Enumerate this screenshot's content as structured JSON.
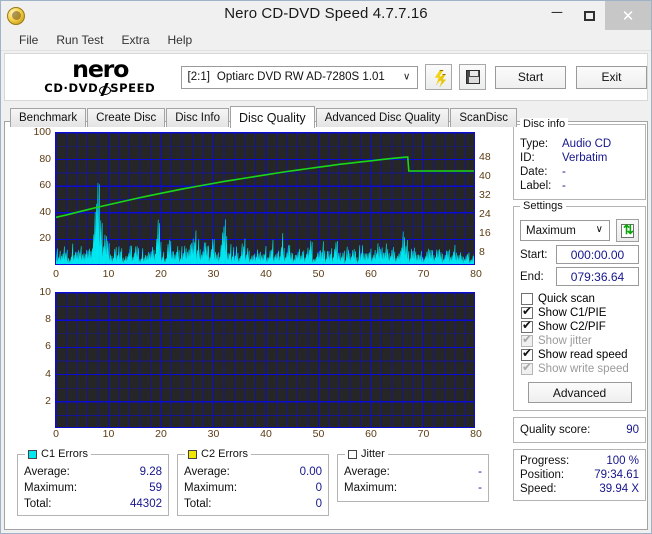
{
  "window": {
    "title": "Nero CD-DVD Speed 4.7.7.16",
    "app_icon": "nero-disc-icon",
    "minimize": "−",
    "maximize": "□",
    "close": "✕"
  },
  "menu": [
    {
      "label": "File"
    },
    {
      "label": "Run Test"
    },
    {
      "label": "Extra"
    },
    {
      "label": "Help"
    }
  ],
  "logo": {
    "main": "nero",
    "left": "CD·DVD",
    "right": "SPEED"
  },
  "toolbar": {
    "drive_id": "[2:1]",
    "drive_name": "Optiarc DVD RW AD-7280S 1.01",
    "caret": "∨",
    "burn_icon": "burn-icon",
    "save_icon": "save-icon",
    "start_label": "Start",
    "exit_label": "Exit"
  },
  "tabs": [
    {
      "label": "Benchmark",
      "active": false
    },
    {
      "label": "Create Disc",
      "active": false
    },
    {
      "label": "Disc Info",
      "active": false
    },
    {
      "label": "Disc Quality",
      "active": true
    },
    {
      "label": "Advanced Disc Quality",
      "active": false
    },
    {
      "label": "ScanDisc",
      "active": false
    }
  ],
  "disc_info": {
    "label": "Disc info",
    "rows": [
      {
        "k": "Type:",
        "v": "Audio CD"
      },
      {
        "k": "ID:",
        "v": "Verbatim"
      },
      {
        "k": "Date:",
        "v": "-"
      },
      {
        "k": "Label:",
        "v": "-"
      }
    ]
  },
  "settings": {
    "label": "Settings",
    "speed": "Maximum",
    "caret": "∨",
    "refresh_icon": "refresh-icon",
    "start_key": "Start:",
    "start_value": "000:00.00",
    "end_key": "End:",
    "end_value": "079:36.64",
    "checkboxes": [
      {
        "label": "Quick scan",
        "checked": false,
        "disabled": false
      },
      {
        "label": "Show C1/PIE",
        "checked": true,
        "disabled": false
      },
      {
        "label": "Show C2/PIF",
        "checked": true,
        "disabled": false
      },
      {
        "label": "Show jitter",
        "checked": true,
        "disabled": true
      },
      {
        "label": "Show read speed",
        "checked": true,
        "disabled": false
      },
      {
        "label": "Show write speed",
        "checked": true,
        "disabled": true
      }
    ],
    "advanced_label": "Advanced"
  },
  "quality": {
    "key": "Quality score:",
    "value": "90"
  },
  "progress": {
    "rows": [
      {
        "k": "Progress:",
        "v": "100 %"
      },
      {
        "k": "Position:",
        "v": "79:34.61"
      },
      {
        "k": "Speed:",
        "v": "39.94 X"
      }
    ]
  },
  "stats": {
    "c1": {
      "label": "C1 Errors",
      "swatch": "cyan",
      "rows": [
        {
          "k": "Average:",
          "v": "9.28"
        },
        {
          "k": "Maximum:",
          "v": "59"
        },
        {
          "k": "Total:",
          "v": "44302"
        }
      ]
    },
    "c2": {
      "label": "C2 Errors",
      "swatch": "yellow",
      "rows": [
        {
          "k": "Average:",
          "v": "0.00"
        },
        {
          "k": "Maximum:",
          "v": "0"
        },
        {
          "k": "Total:",
          "v": "0"
        }
      ]
    },
    "jitter": {
      "label": "Jitter",
      "swatch": "none",
      "rows": [
        {
          "k": "Average:",
          "v": "-"
        },
        {
          "k": "Maximum:",
          "v": "-"
        }
      ]
    }
  },
  "chart_data": [
    {
      "type": "area",
      "id": "c1-pie-chart",
      "title": "C1/PIE errors vs read speed",
      "xlabel": "",
      "ylabel": "",
      "xlim": [
        0,
        80
      ],
      "ylim": [
        0,
        100
      ],
      "y2lim": [
        0,
        56
      ],
      "grid": true,
      "xticks": [
        0,
        10,
        20,
        30,
        40,
        50,
        60,
        70,
        80
      ],
      "yticks": [
        20,
        40,
        60,
        80,
        100
      ],
      "y2ticks": [
        8,
        16,
        24,
        32,
        40,
        48
      ],
      "plot_bg": "#262626",
      "grid_color": "#0b0bd6",
      "series": [
        {
          "name": "C1 errors",
          "color": "#00e7f2",
          "kind": "area",
          "x": [
            0,
            0.6,
            1.2,
            1.8,
            2.4,
            3,
            3.6,
            4.2,
            4.8,
            5.4,
            6,
            6.6,
            7.2,
            7.4,
            7.6,
            7.8,
            8,
            8.2,
            8.4,
            8.6,
            8.8,
            9,
            9.2,
            9.4,
            9.6,
            9.8,
            10,
            10.6,
            11.2,
            11.8,
            12.4,
            13,
            13.6,
            14.2,
            14.8,
            15.4,
            16,
            16.6,
            17.2,
            17.8,
            18.4,
            19,
            19.6,
            20.2,
            20.8,
            21.4,
            21.6,
            22,
            22.6,
            23.2,
            23.8,
            24.4,
            25,
            25.6,
            26.2,
            26.8,
            27.4,
            28,
            28.2,
            28.8,
            29.4,
            30,
            30.6,
            31.2,
            31.8,
            32,
            32.4,
            32.6,
            33,
            33.6,
            34.2,
            34.8,
            35.4,
            36,
            36.6,
            37.2,
            37.8,
            38.4,
            39,
            39.6,
            40.2,
            40.8,
            41.4,
            42,
            42.6,
            43.2,
            43.8,
            44.4,
            45,
            45.6,
            46.2,
            46.8,
            47.4,
            48,
            48.6,
            49.2,
            49.8,
            50.4,
            51,
            51.6,
            52.2,
            52.8,
            53.4,
            54,
            54.6,
            55.2,
            55.8,
            56.4,
            57,
            57.6,
            58.2,
            58.8,
            59.4,
            60,
            60.6,
            61.2,
            61.8,
            62.4,
            63,
            63.6,
            64.2,
            64.8,
            65.4,
            66,
            66.6,
            67,
            67.4,
            68,
            68.6,
            69.2,
            69.8,
            70.4,
            71,
            71.6,
            72.2,
            72.8,
            73.4,
            74,
            74.6,
            75.2,
            75.8,
            76.4,
            77,
            77.6,
            78.2,
            78.8,
            79.4,
            80
          ],
          "y": [
            8,
            14,
            9,
            18,
            7,
            12,
            20,
            9,
            15,
            8,
            13,
            10,
            19,
            30,
            45,
            52,
            50,
            59,
            55,
            47,
            40,
            28,
            15,
            30,
            18,
            12,
            22,
            9,
            14,
            11,
            17,
            8,
            13,
            19,
            10,
            15,
            9,
            12,
            17,
            8,
            14,
            10,
            33,
            12,
            9,
            16,
            24,
            11,
            8,
            15,
            10,
            19,
            9,
            13,
            17,
            27,
            11,
            9,
            25,
            14,
            10,
            18,
            9,
            13,
            21,
            44,
            26,
            14,
            22,
            10,
            16,
            9,
            13,
            18,
            11,
            8,
            15,
            10,
            19,
            9,
            14,
            11,
            17,
            8,
            13,
            20,
            10,
            16,
            9,
            12,
            18,
            8,
            14,
            11,
            19,
            9,
            15,
            10,
            17,
            8,
            13,
            11,
            20,
            9,
            14,
            8,
            16,
            10,
            12,
            9,
            18,
            11,
            8,
            15,
            9,
            13,
            20,
            10,
            16,
            8,
            14,
            11,
            9,
            33,
            24,
            18,
            12,
            9,
            15,
            11,
            8,
            14,
            10,
            13,
            9,
            17,
            11,
            8,
            12,
            9,
            15,
            10,
            14,
            8,
            12,
            9,
            11,
            10,
            8
          ]
        },
        {
          "name": "Read speed",
          "color": "#19d819",
          "kind": "line",
          "axis": "right",
          "x": [
            0,
            2,
            4,
            6,
            8,
            10,
            12,
            14,
            16,
            18,
            20,
            22,
            24,
            26,
            28,
            30,
            32,
            34,
            36,
            38,
            40,
            42,
            44,
            46,
            48,
            50,
            52,
            54,
            56,
            58,
            60,
            62,
            64,
            66,
            67,
            67.2,
            68,
            70,
            72,
            74,
            76,
            78,
            79.6
          ],
          "y": [
            20.5,
            21.5,
            22.6,
            23.7,
            24.8,
            25.8,
            26.8,
            27.8,
            28.8,
            29.7,
            30.6,
            31.5,
            32.4,
            33.2,
            34.0,
            34.8,
            35.6,
            36.3,
            37.0,
            37.7,
            38.4,
            39.1,
            39.8,
            40.4,
            41.0,
            41.6,
            42.2,
            42.8,
            43.3,
            43.8,
            44.3,
            44.8,
            45.3,
            45.7,
            45.9,
            40.0,
            40.0,
            40.0,
            40.0,
            40.0,
            40.0,
            40.0,
            40.0
          ]
        }
      ]
    },
    {
      "type": "area",
      "id": "c2-pif-chart",
      "title": "C2/PIF errors",
      "xlabel": "",
      "ylabel": "",
      "xlim": [
        0,
        80
      ],
      "ylim": [
        0,
        10
      ],
      "grid": true,
      "xticks": [
        0,
        10,
        20,
        30,
        40,
        50,
        60,
        70,
        80
      ],
      "yticks": [
        2,
        4,
        6,
        8,
        10
      ],
      "plot_bg": "#262626",
      "grid_color": "#0b0bd6",
      "series": [
        {
          "name": "C2 errors",
          "color": "#f2e500",
          "kind": "area",
          "x": [
            0,
            80
          ],
          "y": [
            0,
            0
          ]
        }
      ]
    }
  ]
}
